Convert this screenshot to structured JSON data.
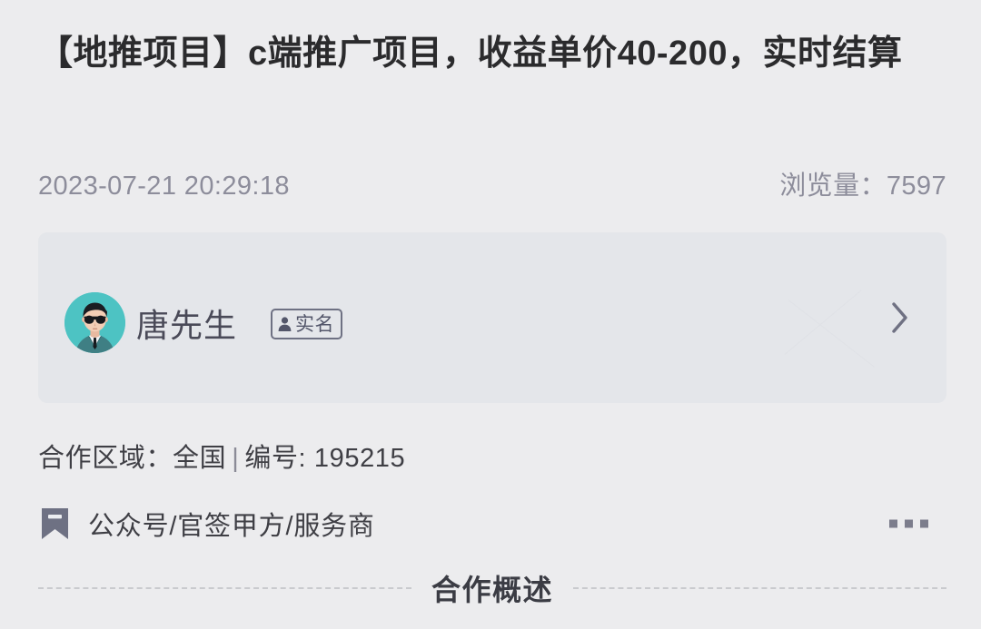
{
  "post": {
    "title": "【地推项目】c端推广项目，收益单价40-200，实时结算",
    "date": "2023-07-21 20:29:18",
    "views_label": "浏览量：",
    "views_count": "7597"
  },
  "user_card": {
    "name": "唐先生",
    "badge_text": "实名",
    "badge_icon": "person-icon",
    "chevron_icon": "chevron-right-icon",
    "avatar_icon": "user-avatar-sunglasses"
  },
  "info": {
    "region_label": "合作区域：",
    "region_value": "全国",
    "separator": "|",
    "id_label": "编号:",
    "id_value": "195215"
  },
  "tag": {
    "icon": "bookmark-icon",
    "text": "公众号/官签甲方/服务商",
    "more_icon": "more-dots-icon"
  },
  "section": {
    "title": "合作概述"
  },
  "colors": {
    "page_background": "#ececee",
    "card_background": "#e4e6ea",
    "title_text": "#2b2b2d",
    "muted_text": "#8d8d9b",
    "body_text": "#3f3f45",
    "accent_slate": "#6e7183",
    "avatar_teal": "#4dc3c3"
  }
}
